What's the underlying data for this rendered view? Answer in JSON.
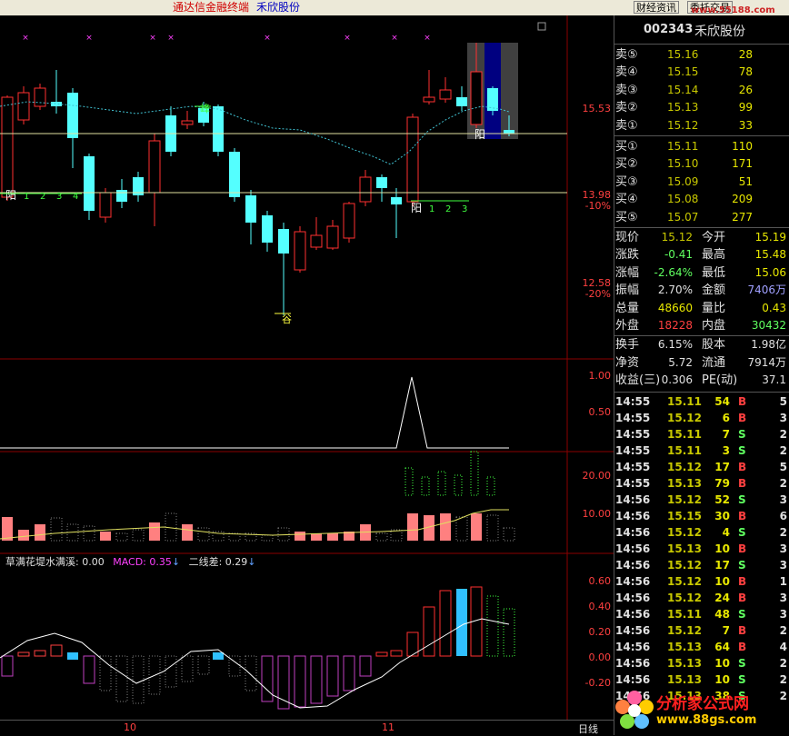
{
  "app": {
    "title": "通达信金融终端",
    "stock_name": "禾欣股份",
    "btn_news": "财经资讯",
    "btn_trade": "委托交易",
    "watermark_url": "www.55188.com"
  },
  "quote": {
    "code": "002343",
    "name": "禾欣股份",
    "sell": [
      {
        "label": "卖⑤",
        "price": "15.16",
        "vol": "28"
      },
      {
        "label": "卖④",
        "price": "15.15",
        "vol": "78"
      },
      {
        "label": "卖③",
        "price": "15.14",
        "vol": "26"
      },
      {
        "label": "卖②",
        "price": "15.13",
        "vol": "99"
      },
      {
        "label": "卖①",
        "price": "15.12",
        "vol": "33"
      }
    ],
    "buy": [
      {
        "label": "买①",
        "price": "15.11",
        "vol": "110"
      },
      {
        "label": "买②",
        "price": "15.10",
        "vol": "171"
      },
      {
        "label": "买③",
        "price": "15.09",
        "vol": "51"
      },
      {
        "label": "买④",
        "price": "15.08",
        "vol": "209"
      },
      {
        "label": "买⑤",
        "price": "15.07",
        "vol": "277"
      }
    ],
    "stats": [
      {
        "l1": "现价",
        "v1": "15.12",
        "l2": "今开",
        "v2": "15.19",
        "c1": "g",
        "c2": "y"
      },
      {
        "l1": "涨跌",
        "v1": "-0.41",
        "l2": "最高",
        "v2": "15.48",
        "c1": "gr",
        "c2": "y"
      },
      {
        "l1": "涨幅",
        "v1": "-2.64%",
        "l2": "最低",
        "v2": "15.06",
        "c1": "gr",
        "c2": "y"
      },
      {
        "l1": "振幅",
        "v1": "2.70%",
        "l2": "金额",
        "v2": "7406万",
        "c1": "w",
        "c2": "bl"
      },
      {
        "l1": "总量",
        "v1": "48660",
        "l2": "量比",
        "v2": "0.43",
        "c1": "y",
        "c2": "y"
      },
      {
        "l1": "外盘",
        "v1": "18228",
        "l2": "内盘",
        "v2": "30432",
        "c1": "r",
        "c2": "gr"
      },
      {
        "l1": "换手",
        "v1": "6.15%",
        "l2": "股本",
        "v2": "1.98亿",
        "c1": "w",
        "c2": "w"
      },
      {
        "l1": "净资",
        "v1": "5.72",
        "l2": "流通",
        "v2": "7914万",
        "c1": "w",
        "c2": "w"
      },
      {
        "l1": "收益(三)",
        "v1": "0.306",
        "l2": "PE(动)",
        "v2": "37.1",
        "c1": "w",
        "c2": "w"
      }
    ],
    "ticks": [
      [
        "14:55",
        "15.11",
        "54",
        "B",
        "5"
      ],
      [
        "14:55",
        "15.12",
        "6",
        "B",
        "3"
      ],
      [
        "14:55",
        "15.11",
        "7",
        "S",
        "2"
      ],
      [
        "14:55",
        "15.11",
        "3",
        "S",
        "2"
      ],
      [
        "14:55",
        "15.12",
        "17",
        "B",
        "5"
      ],
      [
        "14:55",
        "15.13",
        "79",
        "B",
        "2"
      ],
      [
        "14:56",
        "15.12",
        "52",
        "S",
        "3"
      ],
      [
        "14:56",
        "15.15",
        "30",
        "B",
        "6"
      ],
      [
        "14:56",
        "15.12",
        "4",
        "S",
        "2"
      ],
      [
        "14:56",
        "15.13",
        "10",
        "B",
        "3"
      ],
      [
        "14:56",
        "15.12",
        "17",
        "S",
        "3"
      ],
      [
        "14:56",
        "15.12",
        "10",
        "B",
        "1"
      ],
      [
        "14:56",
        "15.12",
        "24",
        "B",
        "3"
      ],
      [
        "14:56",
        "15.11",
        "48",
        "S",
        "3"
      ],
      [
        "14:56",
        "15.12",
        "7",
        "B",
        "2"
      ],
      [
        "14:56",
        "15.13",
        "64",
        "B",
        "4"
      ],
      [
        "14:56",
        "15.13",
        "10",
        "S",
        "2"
      ],
      [
        "14:56",
        "15.13",
        "10",
        "S",
        "2"
      ],
      [
        "14:56",
        "15.13",
        "38",
        "S",
        "2"
      ]
    ]
  },
  "chart": {
    "price_axis": [
      "15.53",
      "13.98",
      "-10%",
      "12.58",
      "-20%"
    ],
    "ind_axis": [
      "1.00",
      "0.50"
    ],
    "vol_axis": [
      "20.00",
      "10.00"
    ],
    "macd_axis": [
      "0.60",
      "0.40",
      "0.20",
      "0.00",
      "-0.20"
    ],
    "labels": {
      "yang1": "阳",
      "yang2": "阳",
      "yang3": "阳",
      "peak": "峰",
      "valley": "谷"
    },
    "nums1": [
      "1",
      "2",
      "3",
      "4"
    ],
    "nums2": [
      "1",
      "2",
      "3"
    ],
    "macd_legend": {
      "name": "草满花堤水满溪: 0.00",
      "macd": "MACD: 0.35",
      "diff": "二线差: 0.29"
    },
    "period": "日线",
    "month_labels": [
      "10",
      "11"
    ]
  },
  "logo": {
    "text": "分析家公式网",
    "url": "www.88gs.com"
  }
}
